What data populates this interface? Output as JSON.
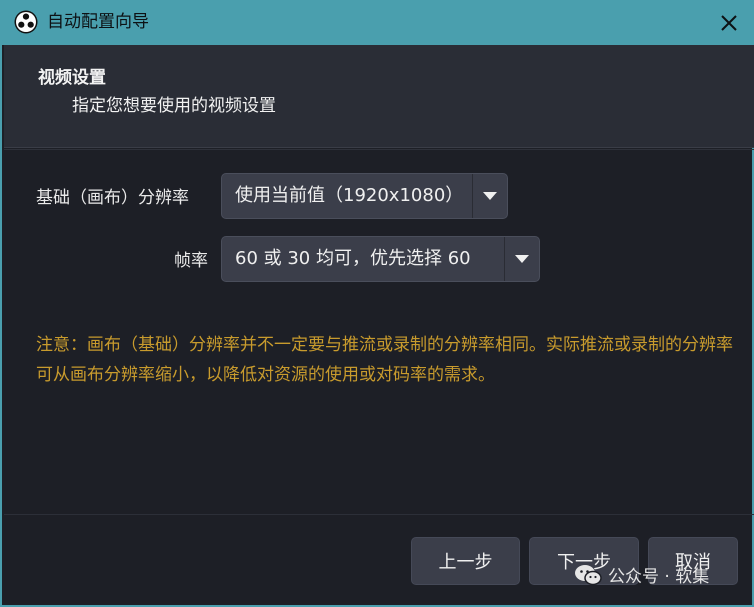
{
  "window": {
    "title": "自动配置向导",
    "close_icon": "close-icon",
    "logo_icon": "obs-logo"
  },
  "header": {
    "title": "视频设置",
    "subtitle": "指定您想要使用的视频设置"
  },
  "form": {
    "resolution": {
      "label": "基础（画布）分辨率",
      "value": "使用当前值（1920x1080）"
    },
    "fps": {
      "label": "帧率",
      "value": "60 或 30 均可，优先选择 60"
    }
  },
  "note": {
    "text": "注意：画布（基础）分辨率并不一定要与推流或录制的分辨率相同。实际推流或录制的分辨率可从画布分辨率缩小，以降低对资源的使用或对码率的需求。"
  },
  "buttons": {
    "back": "上一步",
    "next": "下一步",
    "cancel": "取消"
  },
  "watermark": {
    "text": "公众号 · 软集"
  },
  "colors": {
    "titlebar": "#4a9fae",
    "background": "#1d1f26",
    "header_panel": "#2a2d36",
    "control": "#3b3e4a",
    "note": "#c89b2d"
  }
}
